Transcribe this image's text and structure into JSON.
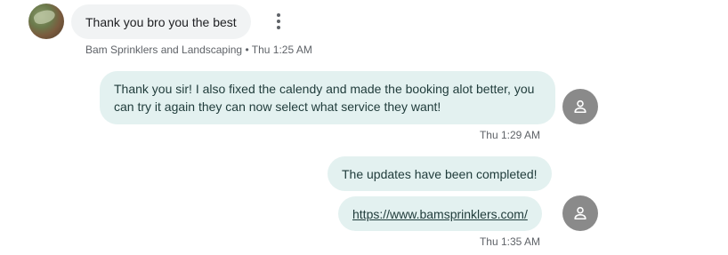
{
  "conversation": {
    "incoming": {
      "text": "Thank you bro you the best",
      "sender": "Bam Sprinklers and Landscaping",
      "separator": "•",
      "time": "Thu 1:25 AM"
    },
    "outgoing_1": {
      "text": "Thank you sir! I also fixed the calendy and made the booking alot better, you can try it again they can now select what service they want!",
      "time": "Thu 1:29 AM"
    },
    "outgoing_2": {
      "text": "The updates have been completed!"
    },
    "outgoing_3": {
      "link": "https://www.bamsprinklers.com/",
      "time": "Thu 1:35 AM"
    }
  },
  "colors": {
    "incoming_bubble": "#f1f3f4",
    "outgoing_bubble": "#e3f1f0",
    "avatar_bg": "#8a8a8a",
    "meta_text": "#5f6368"
  },
  "icons": {
    "more": "more-vert-icon",
    "user": "person-icon"
  }
}
